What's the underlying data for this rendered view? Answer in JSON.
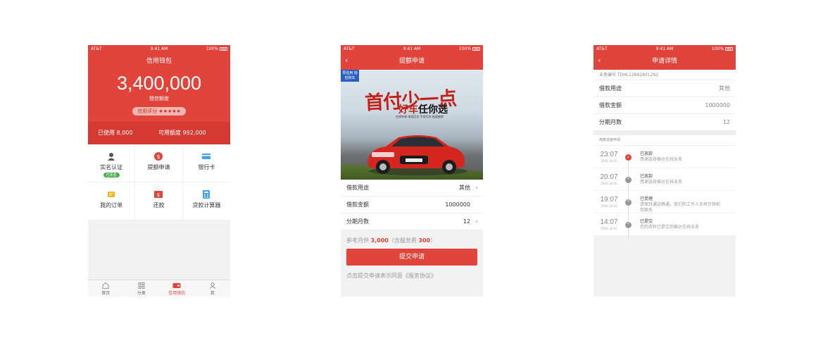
{
  "status": {
    "carrier": "AT&T",
    "time": "9:41 AM",
    "battery": "100%"
  },
  "wallet": {
    "nav_title": "信用钱包",
    "amount": "3,400,000",
    "amount_label": "授信额度",
    "credit_score": "信用评分 ★★★★★",
    "used": "已使用 8,000",
    "available": "可用额度 992,000",
    "grid": [
      {
        "label": "实名认证",
        "badge": "已实名"
      },
      {
        "label": "提额申请"
      },
      {
        "label": "银行卡"
      },
      {
        "label": "我的订单"
      },
      {
        "label": "还款"
      },
      {
        "label": "贷款计算器"
      }
    ],
    "tabs": [
      "首页",
      "分类",
      "信用钱包",
      "我"
    ]
  },
  "apply": {
    "nav_title": "提额申请",
    "ribbon": "周信用 钱包购车",
    "slogan1": "首付少一点",
    "slogan2a": "好车",
    "slogan2b": "任你选",
    "slogan3": "在线申请 电话回访 手续代办 极速放款",
    "rows": [
      {
        "label": "借款用途",
        "value": "其他"
      },
      {
        "label": "借款金额",
        "value": "1000000"
      },
      {
        "label": "分期月数",
        "value": "12"
      }
    ],
    "fee_prefix": "参考月供",
    "fee_amount": "3,000",
    "fee_mid": "（含服务费",
    "fee_service": "300",
    "fee_suffix": "）",
    "submit": "提交申请",
    "agreement": "点击提交申请表示同意《服务协议》"
  },
  "detail": {
    "nav_title": "申请详情",
    "biz_no": "业务编号 TDHL12892801292",
    "rows": [
      {
        "label": "借款用途",
        "value": "其他"
      },
      {
        "label": "借款金额",
        "value": "1000000"
      },
      {
        "label": "分期月数",
        "value": "12"
      }
    ],
    "progress_title": "用款进度申请",
    "timeline": [
      {
        "time": "23:07",
        "date": "2016-10-05",
        "title": "已放款",
        "desc": "感谢选择泰达在线业务"
      },
      {
        "time": "20:07",
        "date": "2016-10-05",
        "title": "已放款",
        "desc": "感谢选择泰达在线业务"
      },
      {
        "time": "19:07",
        "date": "2016-10-02",
        "title": "已受理",
        "desc": "请保持通话畅通，我们的工作人员将尽快和您联系"
      },
      {
        "time": "14:07",
        "date": "2016-10-01",
        "title": "已提交",
        "desc": "您的资料已提交到泰达在线业务"
      }
    ]
  }
}
